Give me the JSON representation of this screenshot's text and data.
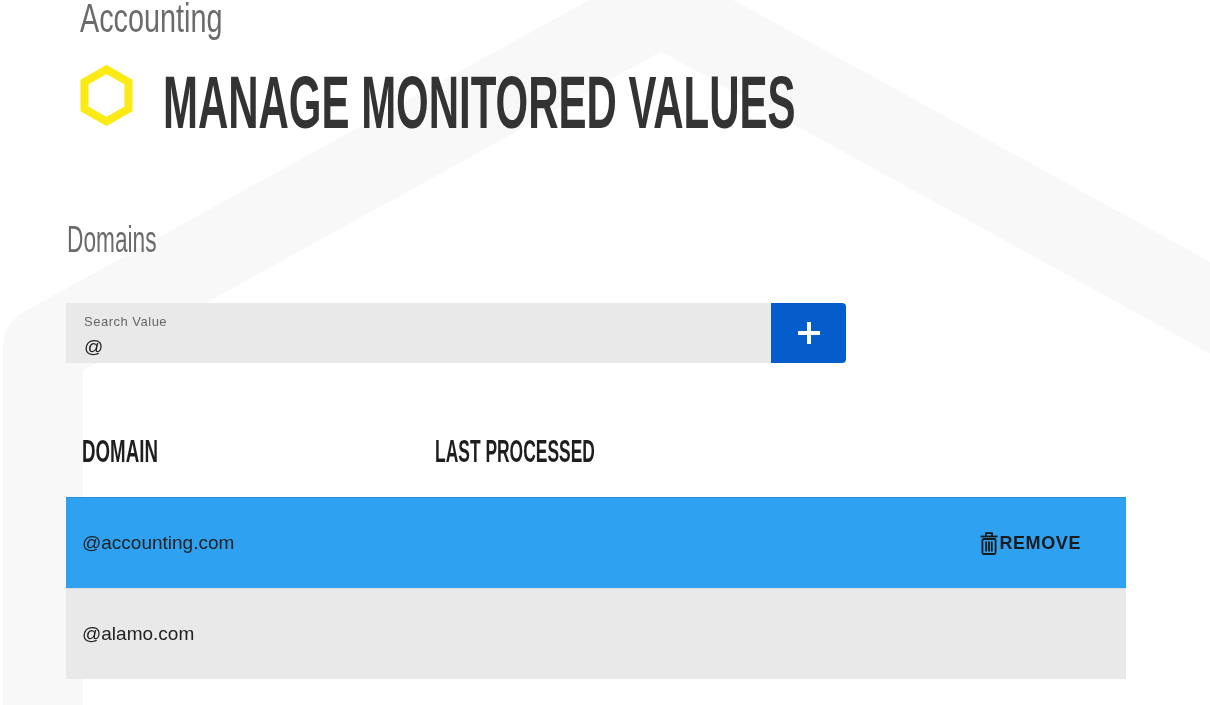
{
  "header": {
    "subtitle": "Accounting",
    "title": "MANAGE MONITORED VALUES"
  },
  "section": {
    "title": "Domains"
  },
  "search": {
    "label": "Search Value",
    "value": "@"
  },
  "table": {
    "columns": [
      "DOMAIN",
      "LAST PROCESSED"
    ],
    "rows": [
      {
        "domain": "@accounting.com",
        "selected": true,
        "action": "REMOVE"
      },
      {
        "domain": "@alamo.com",
        "selected": false
      }
    ]
  }
}
